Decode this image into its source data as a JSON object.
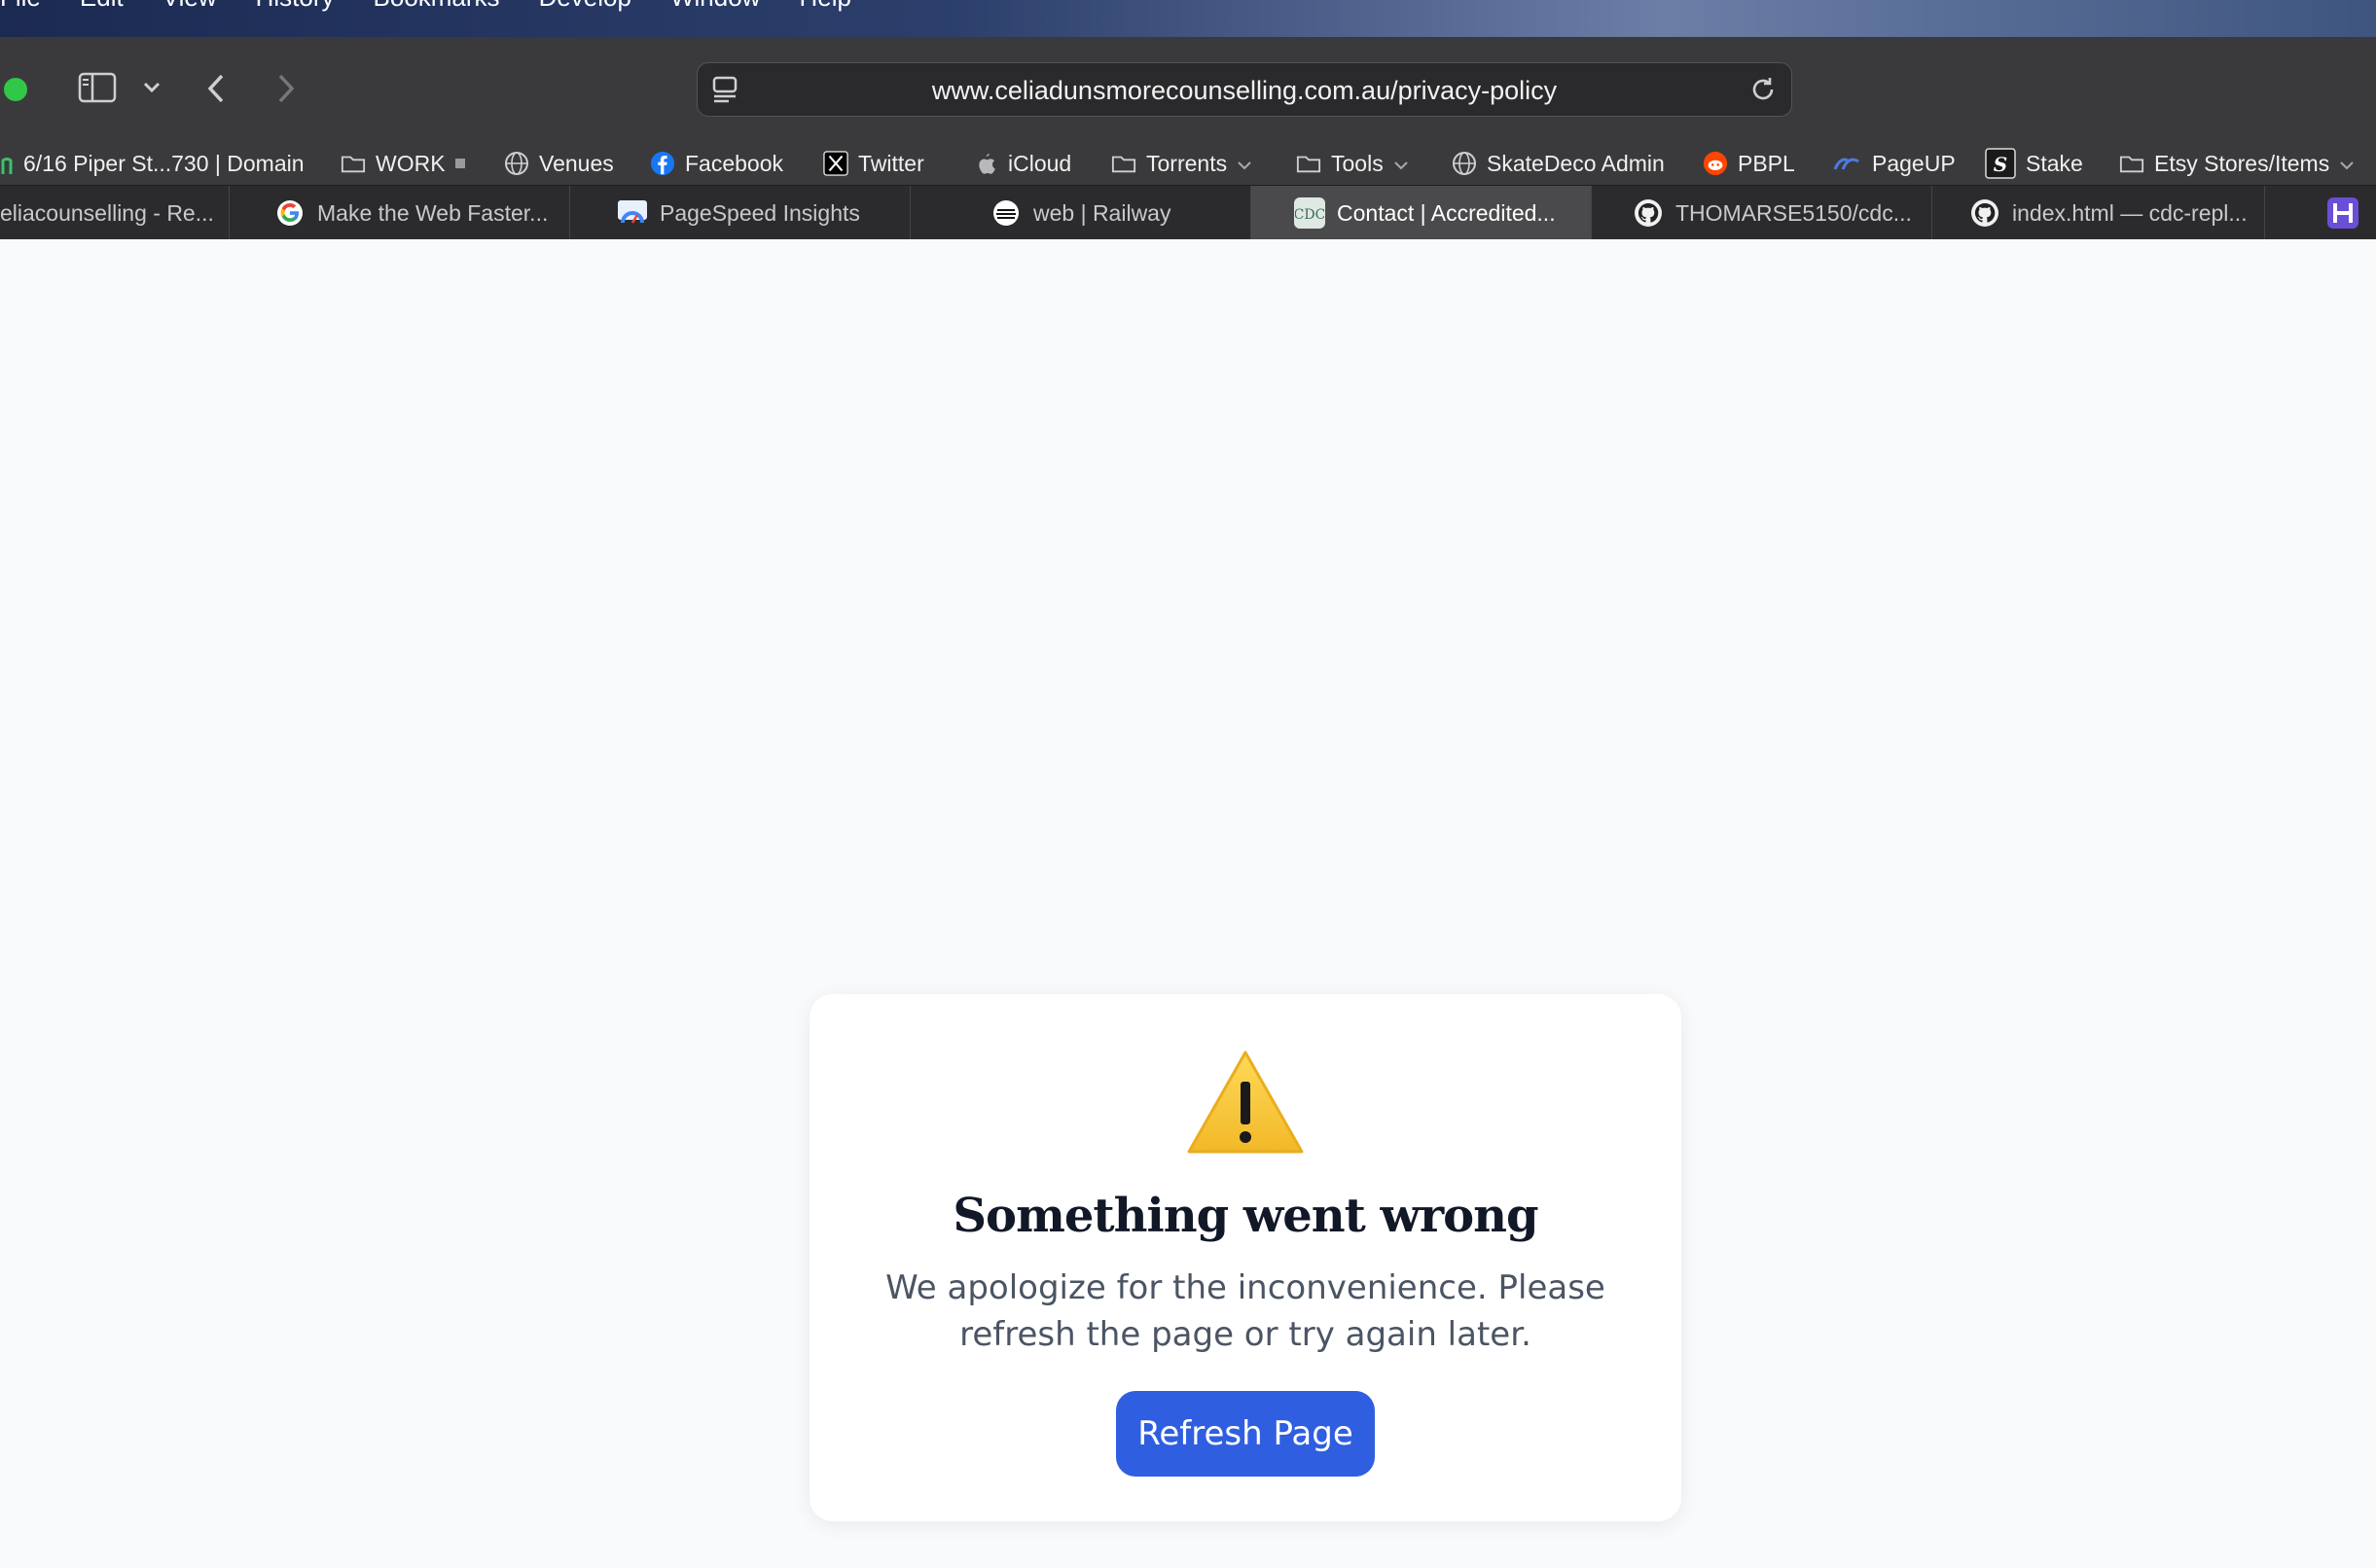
{
  "menubar": {
    "items": [
      "File",
      "Edit",
      "View",
      "History",
      "Bookmarks",
      "Develop",
      "Window",
      "Help"
    ]
  },
  "toolbar": {
    "url": "www.celiadunsmorecounselling.com.au/privacy-policy"
  },
  "bookmarks": [
    {
      "label": "6/16 Piper St...730 | Domain",
      "icon": "domain-icon"
    },
    {
      "label": "WORK",
      "icon": "folder-icon"
    },
    {
      "label": "Venues",
      "icon": "globe-icon"
    },
    {
      "label": "Facebook",
      "icon": "facebook-icon"
    },
    {
      "label": "Twitter",
      "icon": "x-icon"
    },
    {
      "label": "iCloud",
      "icon": "apple-icon"
    },
    {
      "label": "Torrents",
      "icon": "folder-icon"
    },
    {
      "label": "Tools",
      "icon": "folder-icon"
    },
    {
      "label": "SkateDeco Admin",
      "icon": "globe-icon"
    },
    {
      "label": "PBPL",
      "icon": "reddit-icon"
    },
    {
      "label": "PageUP",
      "icon": "pageup-icon"
    },
    {
      "label": "Stake",
      "icon": "stake-icon"
    },
    {
      "label": "Etsy Stores/Items",
      "icon": "folder-icon"
    }
  ],
  "tabs": [
    {
      "label": "eliacounselling - Re..."
    },
    {
      "label": "Make the Web Faster..."
    },
    {
      "label": "PageSpeed Insights"
    },
    {
      "label": "web | Railway"
    },
    {
      "label": "Contact | Accredited..."
    },
    {
      "label": "THOMARSE5150/cdc..."
    },
    {
      "label": "index.html — cdc-repl..."
    }
  ],
  "error": {
    "title": "Something went wrong",
    "message": "We apologize for the inconvenience. Please refresh the page or try again later.",
    "button": "Refresh Page"
  },
  "colors": {
    "button": "#2f5fe0",
    "page_bg": "#f8fafc",
    "warning": "#f4c63d"
  }
}
